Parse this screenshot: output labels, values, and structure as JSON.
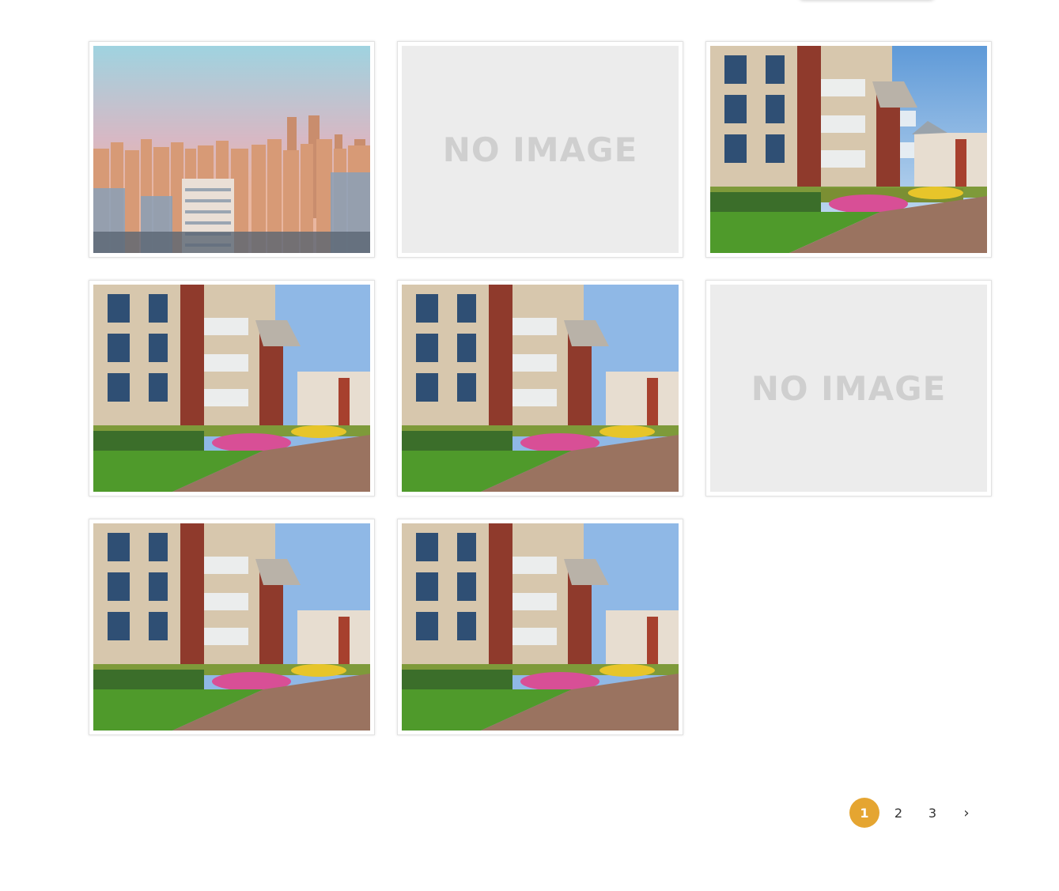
{
  "gallery": {
    "items": [
      {
        "type": "city-skyline-photo"
      },
      {
        "type": "no-image",
        "label": "NO IMAGE"
      },
      {
        "type": "apartment-photo"
      },
      {
        "type": "apartment-photo"
      },
      {
        "type": "apartment-photo"
      },
      {
        "type": "no-image",
        "label": "NO IMAGE"
      },
      {
        "type": "apartment-photo"
      },
      {
        "type": "apartment-photo"
      }
    ]
  },
  "pagination": {
    "pages": [
      "1",
      "2",
      "3"
    ],
    "current": "1",
    "next_label": "›",
    "active_color": "#e5a531"
  }
}
